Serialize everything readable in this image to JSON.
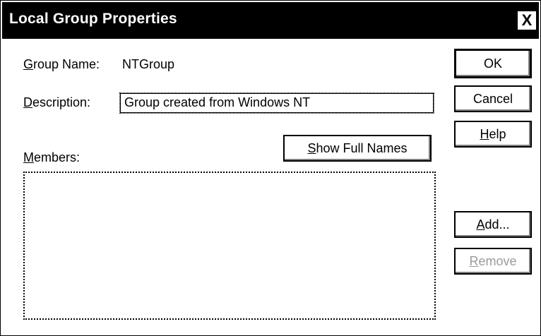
{
  "window": {
    "title": "Local Group Properties",
    "close_glyph": "X"
  },
  "form": {
    "group_name_label_ul": "G",
    "group_name_label_rest": "roup Name:",
    "group_name_value": "NTGroup",
    "description_label_ul": "D",
    "description_label_rest": "escription:",
    "description_value": "Group created from Windows NT",
    "members_label_ul": "M",
    "members_label_rest": "embers:"
  },
  "buttons": {
    "ok": "OK",
    "cancel": "Cancel",
    "help_ul": "H",
    "help_rest": "elp",
    "show_full_ul": "S",
    "show_full_rest": "how Full Names",
    "add_ul": "A",
    "add_rest": "dd...",
    "remove_ul": "R",
    "remove_rest": "emove"
  },
  "members": []
}
